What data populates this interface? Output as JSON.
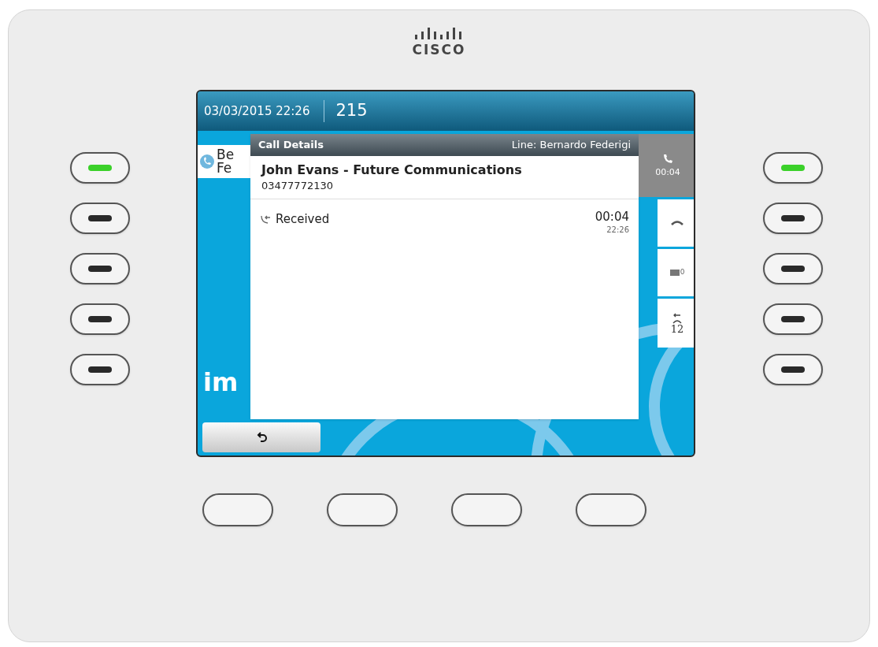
{
  "logo_text": "CISCO",
  "left_keys": [
    {
      "lit": true
    },
    {
      "lit": false
    },
    {
      "lit": false
    },
    {
      "lit": false
    },
    {
      "lit": false
    }
  ],
  "right_keys": [
    {
      "lit": true
    },
    {
      "lit": false
    },
    {
      "lit": false
    },
    {
      "lit": false
    },
    {
      "lit": false
    }
  ],
  "screen": {
    "header": {
      "datetime": "03/03/2015 22:26",
      "extension": "215"
    },
    "line_label": [
      "Be",
      "Fe"
    ],
    "wallpaper_text": "im",
    "dialog": {
      "title": "Call Details",
      "line": "Line: Bernardo Federigi",
      "caller_name": "John Evans - Future Communications",
      "caller_number": "03477772130",
      "calls": [
        {
          "kind": "received",
          "label": "Received",
          "duration": "00:04",
          "time": "22:26"
        }
      ]
    },
    "session_keys": [
      {
        "kind": "active_call",
        "text": "00:04"
      },
      {
        "kind": "end_call"
      },
      {
        "kind": "voicemail",
        "text": "0"
      },
      {
        "kind": "callback",
        "text": "12"
      }
    ],
    "softkeys": [
      {
        "kind": "back"
      }
    ]
  }
}
